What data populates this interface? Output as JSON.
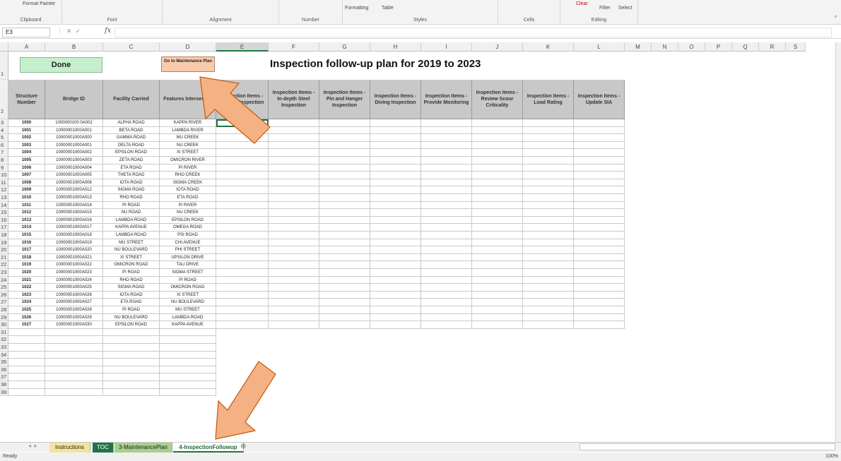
{
  "ribbon": {
    "groups": [
      {
        "label": "Clipboard",
        "item": "Format Painter"
      },
      {
        "label": "Font"
      },
      {
        "label": "Alignment"
      },
      {
        "label": "Number"
      },
      {
        "label": "Styles",
        "items": [
          "Formatting",
          "Table"
        ]
      },
      {
        "label": "Cells"
      },
      {
        "label": "Editing",
        "items": [
          "Clear",
          "Filter",
          "Select"
        ]
      }
    ]
  },
  "formula_bar": {
    "name_box": "E3",
    "fx": "fx",
    "value": ""
  },
  "columns": [
    "A",
    "B",
    "C",
    "D",
    "E",
    "F",
    "G",
    "H",
    "I",
    "J",
    "K",
    "L",
    "M",
    "N",
    "O",
    "P",
    "Q",
    "R",
    "S"
  ],
  "selected_column": "E",
  "buttons": {
    "done": "Done",
    "maintenance": "Go to Maintenance Plan"
  },
  "title": "Inspection follow-up plan for 2019 to 2023",
  "headers": [
    "Structure Number",
    "Bridge ID",
    "Facility Carried",
    "Features Intersected",
    "Inspection Items - Special Inspection",
    "Inspection Items - In-depth Steel Inspection",
    "Inspection Items - Pin and Hanger Inspection",
    "Inspection Items - Diving Inspection",
    "Inspection Items - Provide Monitoring",
    "Inspection Items - Review Scour Criticality",
    "Inspection Items - Load Rating",
    "Inspection Items - Update SIA"
  ],
  "rows": [
    [
      "1000",
      "1000000100 0A002",
      "ALPHA ROAD",
      "KAPPA RIVER"
    ],
    [
      "1001",
      "10000001000A001",
      "BETA ROAD",
      "LAMBDA RIVER"
    ],
    [
      "1002",
      "10000001000A000",
      "GAMMA ROAD",
      "MU CREEK"
    ],
    [
      "1003",
      "10000001000A001",
      "DELTA ROAD",
      "NU CREEK"
    ],
    [
      "1004",
      "10000001000A002",
      "EPSILON ROAD",
      "XI STREET"
    ],
    [
      "1005",
      "10000001000A003",
      "ZETA ROAD",
      "OMICRON RIVER"
    ],
    [
      "1006",
      "10000001000A004",
      "ETA ROAD",
      "PI RIVER"
    ],
    [
      "1007",
      "10000001000A005",
      "THETA ROAD",
      "RHO CREEK"
    ],
    [
      "1008",
      "10000001000A006",
      "IOTA ROAD",
      "SIGMA CREEK"
    ],
    [
      "1009",
      "10000001000A012",
      "SIGMA ROAD",
      "IOTA ROAD"
    ],
    [
      "1010",
      "10000001000A013",
      "RHO ROAD",
      "ETA ROAD"
    ],
    [
      "1011",
      "10000001000A014",
      "PI ROAD",
      "PI RIVER"
    ],
    [
      "1012",
      "10000001000A015",
      "NU ROAD",
      "NU CREEK"
    ],
    [
      "1013",
      "10000001000A016",
      "LAMBDA ROAD",
      "EPSILON ROAD"
    ],
    [
      "1014",
      "10000001000A017",
      "KAPPA AVENUE",
      "OMEGA ROAD"
    ],
    [
      "1015",
      "10000001000A018",
      "LAMBDA ROAD",
      "PSI ROAD"
    ],
    [
      "1016",
      "10000001000A019",
      "MU STREET",
      "CHI AVENUE"
    ],
    [
      "1017",
      "10000001000A020",
      "NU BOULEVARD",
      "PHI STREET"
    ],
    [
      "1018",
      "10000001000A021",
      "XI STREET",
      "UPSILON DRIVE"
    ],
    [
      "1019",
      "10000001000A022",
      "OMICRON ROAD",
      "TAU DRIVE"
    ],
    [
      "1020",
      "10000001000A023",
      "PI ROAD",
      "SIGMA STREET"
    ],
    [
      "1021",
      "10000001000A024",
      "RHO ROAD",
      "PI ROAD"
    ],
    [
      "1022",
      "10000001000A025",
      "SIGMA ROAD",
      "OMICRON ROAD"
    ],
    [
      "1023",
      "10000001000A026",
      "IOTA ROAD",
      "XI STREET"
    ],
    [
      "1024",
      "10000001000A027",
      "ETA ROAD",
      "NU BOULEVARD"
    ],
    [
      "1025",
      "10000001000A028",
      "PI ROAD",
      "MU STREET"
    ],
    [
      "1026",
      "10000001000A029",
      "NU BOULEVARD",
      "LAMBDA ROAD"
    ],
    [
      "1027",
      "10000001000A030",
      "EPSILON ROAD",
      "KAPPA AVENUE"
    ]
  ],
  "row_numbers": [
    "1",
    "2",
    "3",
    "4",
    "5",
    "6",
    "7",
    "8",
    "9",
    "10",
    "11",
    "12",
    "13",
    "14",
    "15",
    "16",
    "17",
    "18",
    "19",
    "20",
    "21",
    "22",
    "23",
    "24",
    "25",
    "26",
    "27",
    "28",
    "29",
    "30",
    "31",
    "32",
    "33",
    "34",
    "35",
    "36",
    "37",
    "38",
    "39"
  ],
  "tabs": [
    "Instructions",
    "TOC",
    "3-MaintenancePlan",
    "4-InspectionFollowup"
  ],
  "status": {
    "ready": "Ready",
    "zoom": "100%"
  },
  "colors": {
    "done_bg": "#c6efce",
    "maint_bg": "#f8cbad",
    "arrow": "#f4b183",
    "header_bg": "#c8c8c8",
    "excel_green": "#217346"
  }
}
